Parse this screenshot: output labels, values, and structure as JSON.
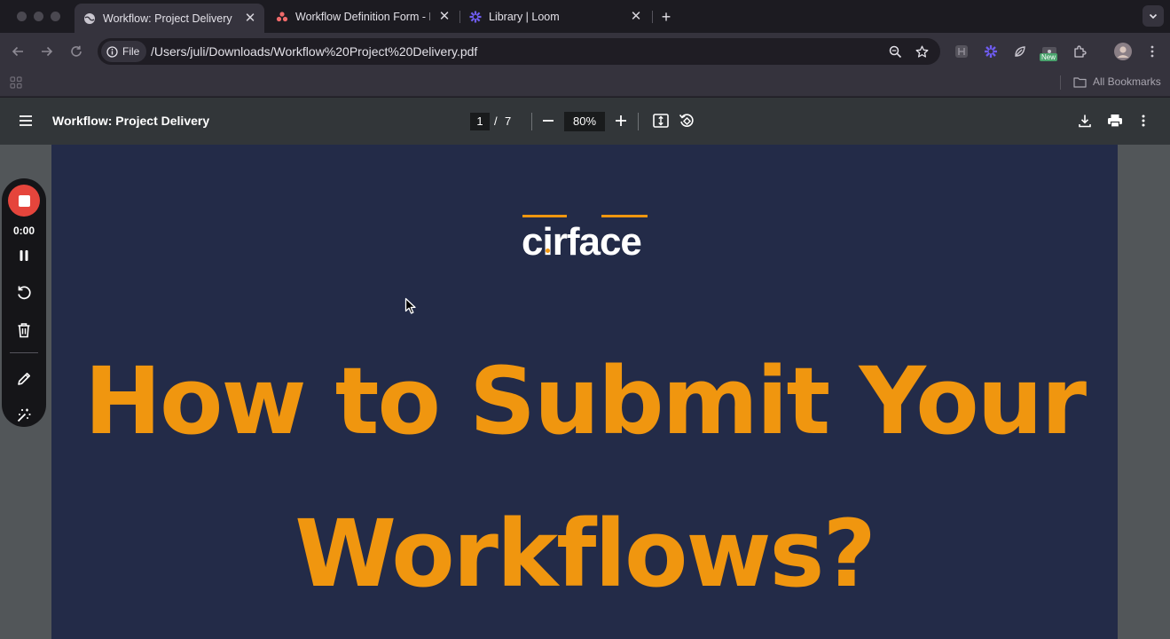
{
  "browser": {
    "tabs": [
      {
        "label": "Workflow: Project Delivery",
        "icon": "globe-icon",
        "active": true
      },
      {
        "label": "Workflow Definition Form - Fo",
        "icon": "asana-icon",
        "active": false
      },
      {
        "label": "Library | Loom",
        "icon": "loom-icon",
        "active": false
      }
    ],
    "new_tab_symbol": "+",
    "close_symbol": "✕",
    "omnibox": {
      "chip_label": "File",
      "url": "/Users/juli/Downloads/Workflow%20Project%20Delivery.pdf"
    },
    "extensions": {
      "new_badge": "New"
    },
    "bookmarks": {
      "all_label": "All Bookmarks"
    }
  },
  "pdf": {
    "title": "Workflow: Project Delivery",
    "current_page": "1",
    "separator": "/",
    "total_pages": "7",
    "zoom": "80%"
  },
  "document": {
    "logo_text": "cirface",
    "headline_line1": "How to Submit Your",
    "headline_line2": "Workflows?",
    "background_color": "#232b48",
    "headline_color": "#f0960f"
  },
  "recorder": {
    "timer": "0:00",
    "stop_color": "#e5453c"
  }
}
